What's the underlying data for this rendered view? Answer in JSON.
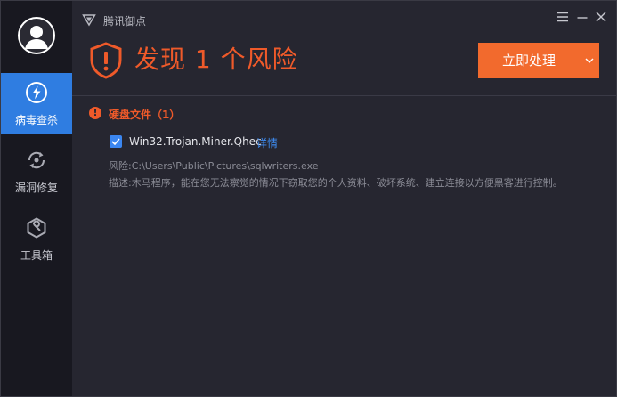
{
  "app": {
    "title": "腾讯御点"
  },
  "sidebar": {
    "items": [
      {
        "label": "病毒查杀",
        "icon": "lightning-icon",
        "active": true
      },
      {
        "label": "漏洞修复",
        "icon": "repair-cycle-icon",
        "active": false
      },
      {
        "label": "工具箱",
        "icon": "toolbox-hex-icon",
        "active": false
      }
    ]
  },
  "header": {
    "risk_title": "发现 1 个风险",
    "action_label": "立即处理"
  },
  "content": {
    "category": {
      "label": "硬盘文件（1）",
      "icon_text": "!"
    },
    "threat": {
      "name": "Win32.Trojan.Miner.Qhec",
      "detail_link": "详情",
      "checked": true,
      "path": "风险:C:\\Users\\Public\\Pictures\\sqlwriters.exe",
      "description": "描述:木马程序，能在您无法察觉的情况下窃取您的个人资料、破坏系统、建立连接以方便黑客进行控制。"
    }
  },
  "colors": {
    "accent": "#f26a2d",
    "danger": "#ef5a2a",
    "active_nav": "#2f7de1",
    "link": "#3d8cf2"
  }
}
